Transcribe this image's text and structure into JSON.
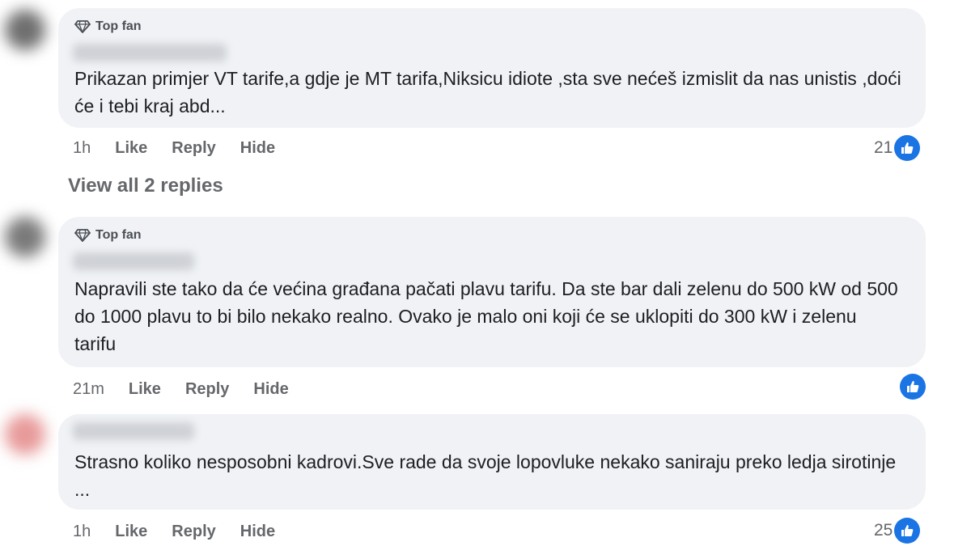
{
  "comments": [
    {
      "badge": "Top fan",
      "text": "Prikazan primjer VT tarife,a gdje je MT tarifa,Niksicu idiote ,sta sve nećeš izmislit da nas unistis ,doći će i tebi kraj abd...",
      "time": "1h",
      "like": "Like",
      "reply": "Reply",
      "hide": "Hide",
      "reaction_count": "21"
    },
    {
      "badge": "Top fan",
      "text": "Napravili ste tako da će većina građana pačati plavu tarifu. Da ste bar dali zelenu do 500 kW od 500 do 1000 plavu to bi bilo nekako realno. Ovako je malo oni koji će se uklopiti do 300 kW i zelenu tarifu",
      "time": "21m",
      "like": "Like",
      "reply": "Reply",
      "hide": "Hide",
      "reaction_count": ""
    },
    {
      "badge": "",
      "text": "Strasno koliko nesposobni kadrovi.Sve rade da svoje lopovluke nekako saniraju preko ledja sirotinje ...",
      "time": "1h",
      "like": "Like",
      "reply": "Reply",
      "hide": "Hide",
      "reaction_count": "25"
    }
  ],
  "view_replies": "View all 2 replies",
  "colors": {
    "bubble": "#f0f2f5",
    "meta": "#65676b",
    "like_blue": "#1b74e4"
  }
}
